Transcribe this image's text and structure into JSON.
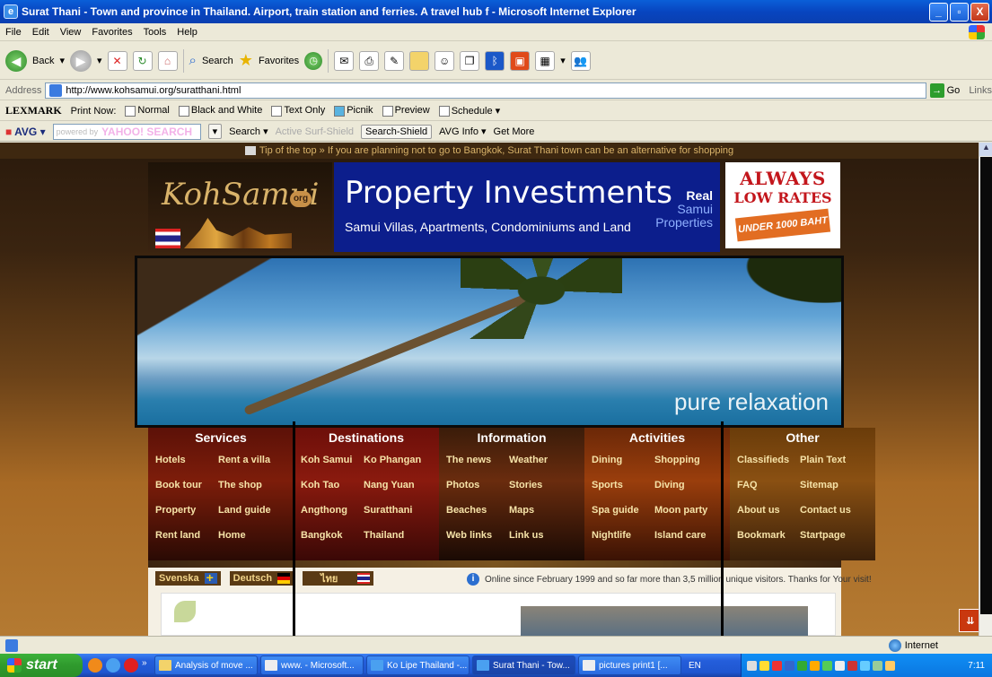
{
  "window": {
    "title": "Surat Thani - Town and province in Thailand. Airport, train station and ferries. A travel hub f - Microsoft Internet Explorer",
    "minimize": "_",
    "maximize": "▫",
    "close": "X"
  },
  "menu": [
    "File",
    "Edit",
    "View",
    "Favorites",
    "Tools",
    "Help"
  ],
  "toolbar": {
    "back": "Back",
    "search": "Search",
    "favorites": "Favorites"
  },
  "address": {
    "label": "Address",
    "url": "http://www.kohsamui.org/suratthani.html",
    "go": "Go",
    "links": "Links"
  },
  "lexmark": {
    "brand": "LEXMARK",
    "print_now": "Print Now:",
    "normal": "Normal",
    "bw": "Black and White",
    "text_only": "Text Only",
    "picnik": "Picnik",
    "preview": "Preview",
    "schedule": "Schedule"
  },
  "avg": {
    "logo": "AVG",
    "powered": "powered by",
    "yahoo": "YAHOO! SEARCH",
    "search": "Search",
    "active_shield": "Active Surf-Shield",
    "search_shield": "Search-Shield",
    "avg_info": "AVG Info",
    "get_more": "Get More"
  },
  "page": {
    "tip": "Tip of the top » If you are planning not to go to Bangkok, Surat Thani town can be an alternative for shopping",
    "logo_text": "KohSamui",
    "logo_org": "org",
    "ad_property": {
      "title": "Property Investments",
      "subtitle": "Samui Villas, Apartments, Condominiums and Land",
      "brand_line1": "Real",
      "brand_line2": "Samui",
      "brand_line3": "Properties"
    },
    "ad_rates": {
      "line1": "ALWAYS",
      "line2": "LOW RATES",
      "line3": "UNDER 1000 BAHT"
    },
    "hero_tagline": "pure relaxation",
    "nav": [
      {
        "heading": "Services",
        "items": [
          "Hotels",
          "Rent a villa",
          "Book tour",
          "The shop",
          "Property",
          "Land guide",
          "Rent land",
          "Home"
        ]
      },
      {
        "heading": "Destinations",
        "items": [
          "Koh Samui",
          "Ko Phangan",
          "Koh Tao",
          "Nang Yuan",
          "Angthong",
          "Suratthani",
          "Bangkok",
          "Thailand"
        ]
      },
      {
        "heading": "Information",
        "items": [
          "The news",
          "Weather",
          "Photos",
          "Stories",
          "Beaches",
          "Maps",
          "Web links",
          "Link us"
        ]
      },
      {
        "heading": "Activities",
        "items": [
          "Dining",
          "Shopping",
          "Sports",
          "Diving",
          "Spa guide",
          "Moon party",
          "Nightlife",
          "Island care"
        ]
      },
      {
        "heading": "Other",
        "items": [
          "Classifieds",
          "Plain Text",
          "FAQ",
          "Sitemap",
          "About us",
          "Contact us",
          "Bookmark",
          "Startpage"
        ]
      }
    ],
    "languages": [
      "Svenska",
      "Deutsch",
      "ไทย"
    ],
    "online_text": "Online since February 1999 and so far more than 3,5 million unique visitors. Thanks for Your visit!"
  },
  "status": {
    "zone": "Internet"
  },
  "taskbar": {
    "start": "start",
    "tasks": [
      "Analysis of move ...",
      "www. - Microsoft...",
      "Ko Lipe Thailand -...",
      "Surat Thani - Tow...",
      "pictures print1 [..."
    ],
    "active_task": 3,
    "lang": "EN",
    "clock": "7:11"
  },
  "colors": {
    "title_bar": "#0a5fd8",
    "nav_link": "#f6e3a8",
    "ad_blue": "#0c1e8c",
    "ad_red": "#c3161c"
  }
}
